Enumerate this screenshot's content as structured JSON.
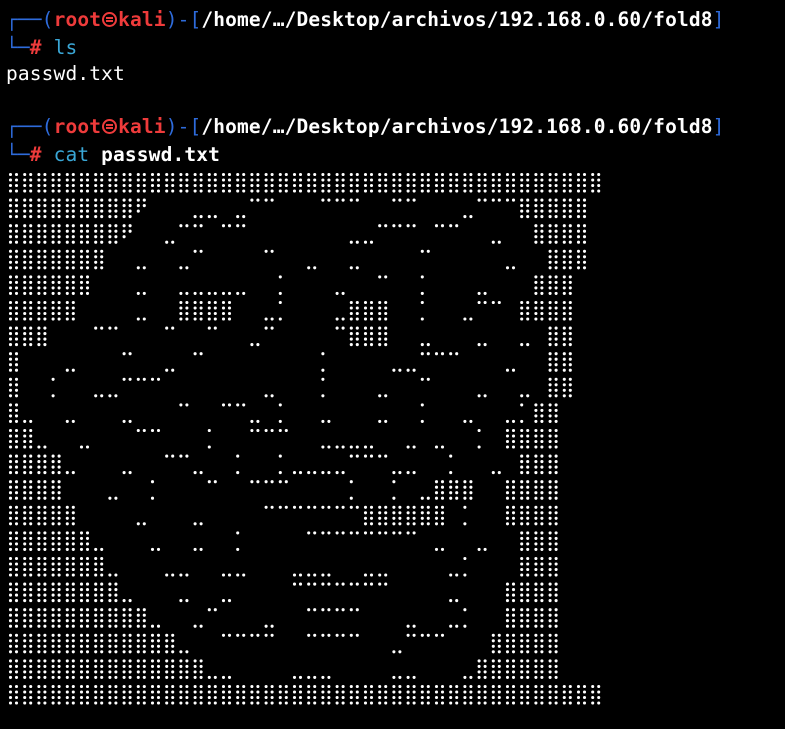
{
  "prompts": [
    {
      "open": "┌──(",
      "user": "root",
      "skull_icon": "skull-icon",
      "host": "kali",
      "mid": ")-[",
      "path": "/home/…/Desktop/archivos/192.168.0.60/fold8",
      "close": "]",
      "corner": "└─",
      "hash": "#",
      "command": "ls",
      "argument": ""
    },
    {
      "open": "┌──(",
      "user": "root",
      "skull_icon": "skull-icon",
      "host": "kali",
      "mid": ")-[",
      "path": "/home/…/Desktop/archivos/192.168.0.60/fold8",
      "close": "]",
      "corner": "└─",
      "hash": "#",
      "command": "cat",
      "argument": "passwd.txt"
    }
  ],
  "outputs": {
    "ls_result": "passwd.txt"
  },
  "colors": {
    "background": "#000000",
    "frame_blue": "#2e6bdb",
    "root_red": "#ee3b3b",
    "command_cyan": "#3aa7d6",
    "text_white": "#ffffff"
  },
  "ascii_art": {
    "description_icon": "braille-troll-face-art",
    "rows": [
      "##########################################",
      "#########*   .. .--   ---  --   .---#####",
      "########*  .-- --       ..--- --  .  ####",
      "#######  .  .-    -  .  .    -     .  ###",
      "######   .  .....  :   .  -  :   .   ###",
      "#####    .  ####  .:   .###  :  .-- ####",
      "###   --   -  -  .-    -###  .   .  . ##",
      "#   .   -  . -        :    ..---   .  ##",
      "#  :  ..---       .   :   .  -   .  . ##",
      "#.  .   .   -  --. :  .   .  :  .  .:##",
      "##.  .   --   :  ---  ....  . .  : ####",
      "####.   .  --.  :  :....---..  :  . ###",
      "####   .  :   -  ---    :  : .###  ####",
      "#####    .   .    -------###### :  ####",
      "######.   .  .  :    -------- .  .  ###",
      "#######.   ..  ..   ...  ..    .:   ###",
      "########.   .  .    -------    .   ####",
      "##########.  .-   .  ----   .  .:  ####",
      "############.  ----  ----  .---   #####",
      "##############..    ...    ..   .######",
      "##########################################"
    ]
  }
}
